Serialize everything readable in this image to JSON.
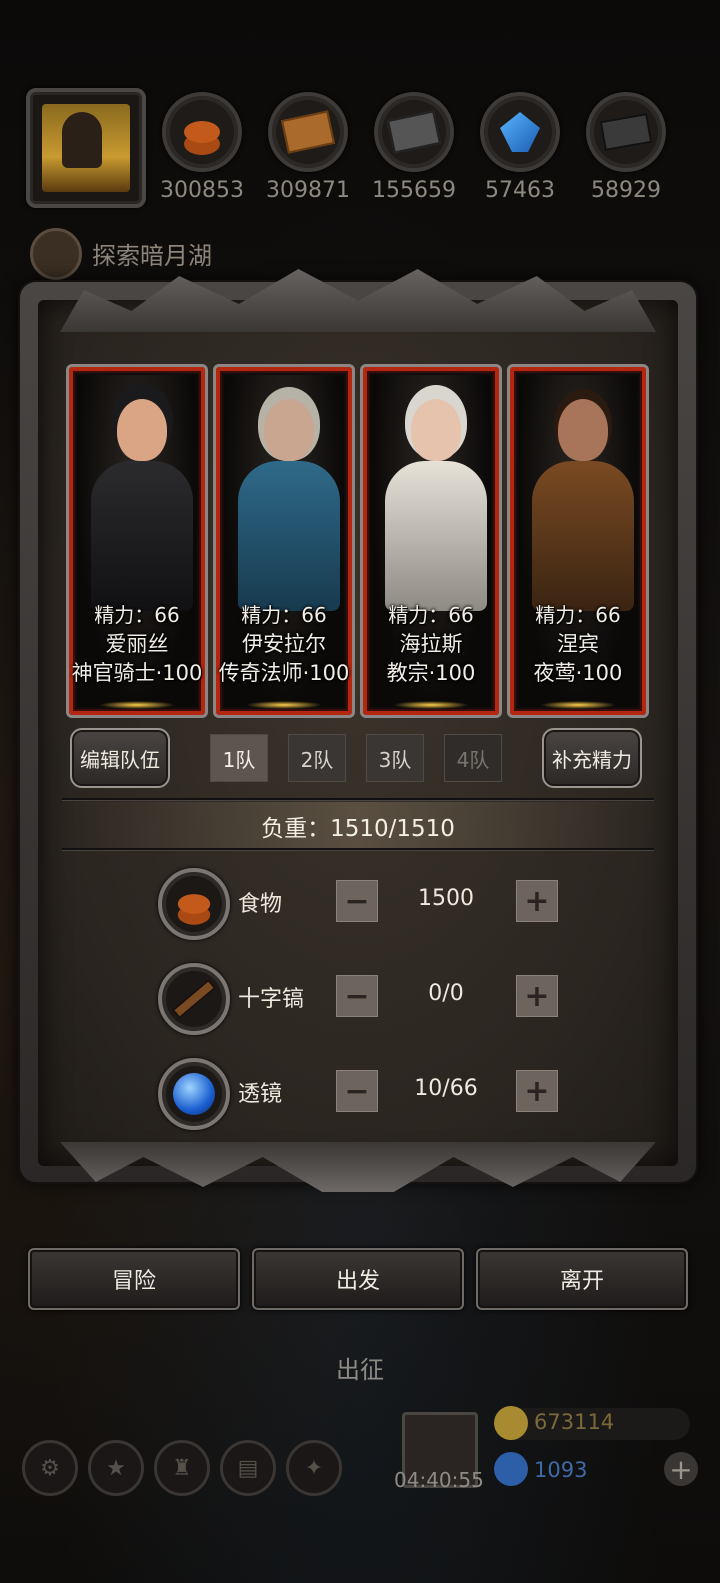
{
  "resources": [
    {
      "icon": "food-icon",
      "value": "300853"
    },
    {
      "icon": "wood-icon",
      "value": "309871"
    },
    {
      "icon": "stone-icon",
      "value": "155659"
    },
    {
      "icon": "crystal-icon",
      "value": "57463"
    },
    {
      "icon": "iron-icon",
      "value": "58929"
    }
  ],
  "quest": {
    "text": "探索暗月湖"
  },
  "heroes": [
    {
      "stamina": "精力：66",
      "name": "爱丽丝",
      "class": "神官骑士·100"
    },
    {
      "stamina": "精力：66",
      "name": "伊安拉尔",
      "class": "传奇法师·100"
    },
    {
      "stamina": "精力：66",
      "name": "海拉斯",
      "class": "教宗·100"
    },
    {
      "stamina": "精力：66",
      "name": "涅宾",
      "class": "夜莺·100"
    }
  ],
  "team": {
    "edit_label": "编辑队伍",
    "tabs": [
      "1队",
      "2队",
      "3队",
      "4队"
    ],
    "refill_label": "补充精力"
  },
  "load": {
    "text": "负重：1510/1510"
  },
  "supplies": [
    {
      "icon": "food-icon",
      "label": "食物",
      "value": "1500"
    },
    {
      "icon": "pickaxe-icon",
      "label": "十字镐",
      "value": "0/0"
    },
    {
      "icon": "lens-icon",
      "label": "透镜",
      "value": "10/66"
    }
  ],
  "actions": {
    "adventure": "冒险",
    "depart": "出发",
    "leave": "离开"
  },
  "background": {
    "depart_label": "出征",
    "timer": "04:40:55",
    "gold": "673114",
    "gems": "1093"
  },
  "colors": {
    "accent_red": "#b3260f",
    "gold_text": "#7a6a3a",
    "gem_text": "#3f6aa8"
  }
}
